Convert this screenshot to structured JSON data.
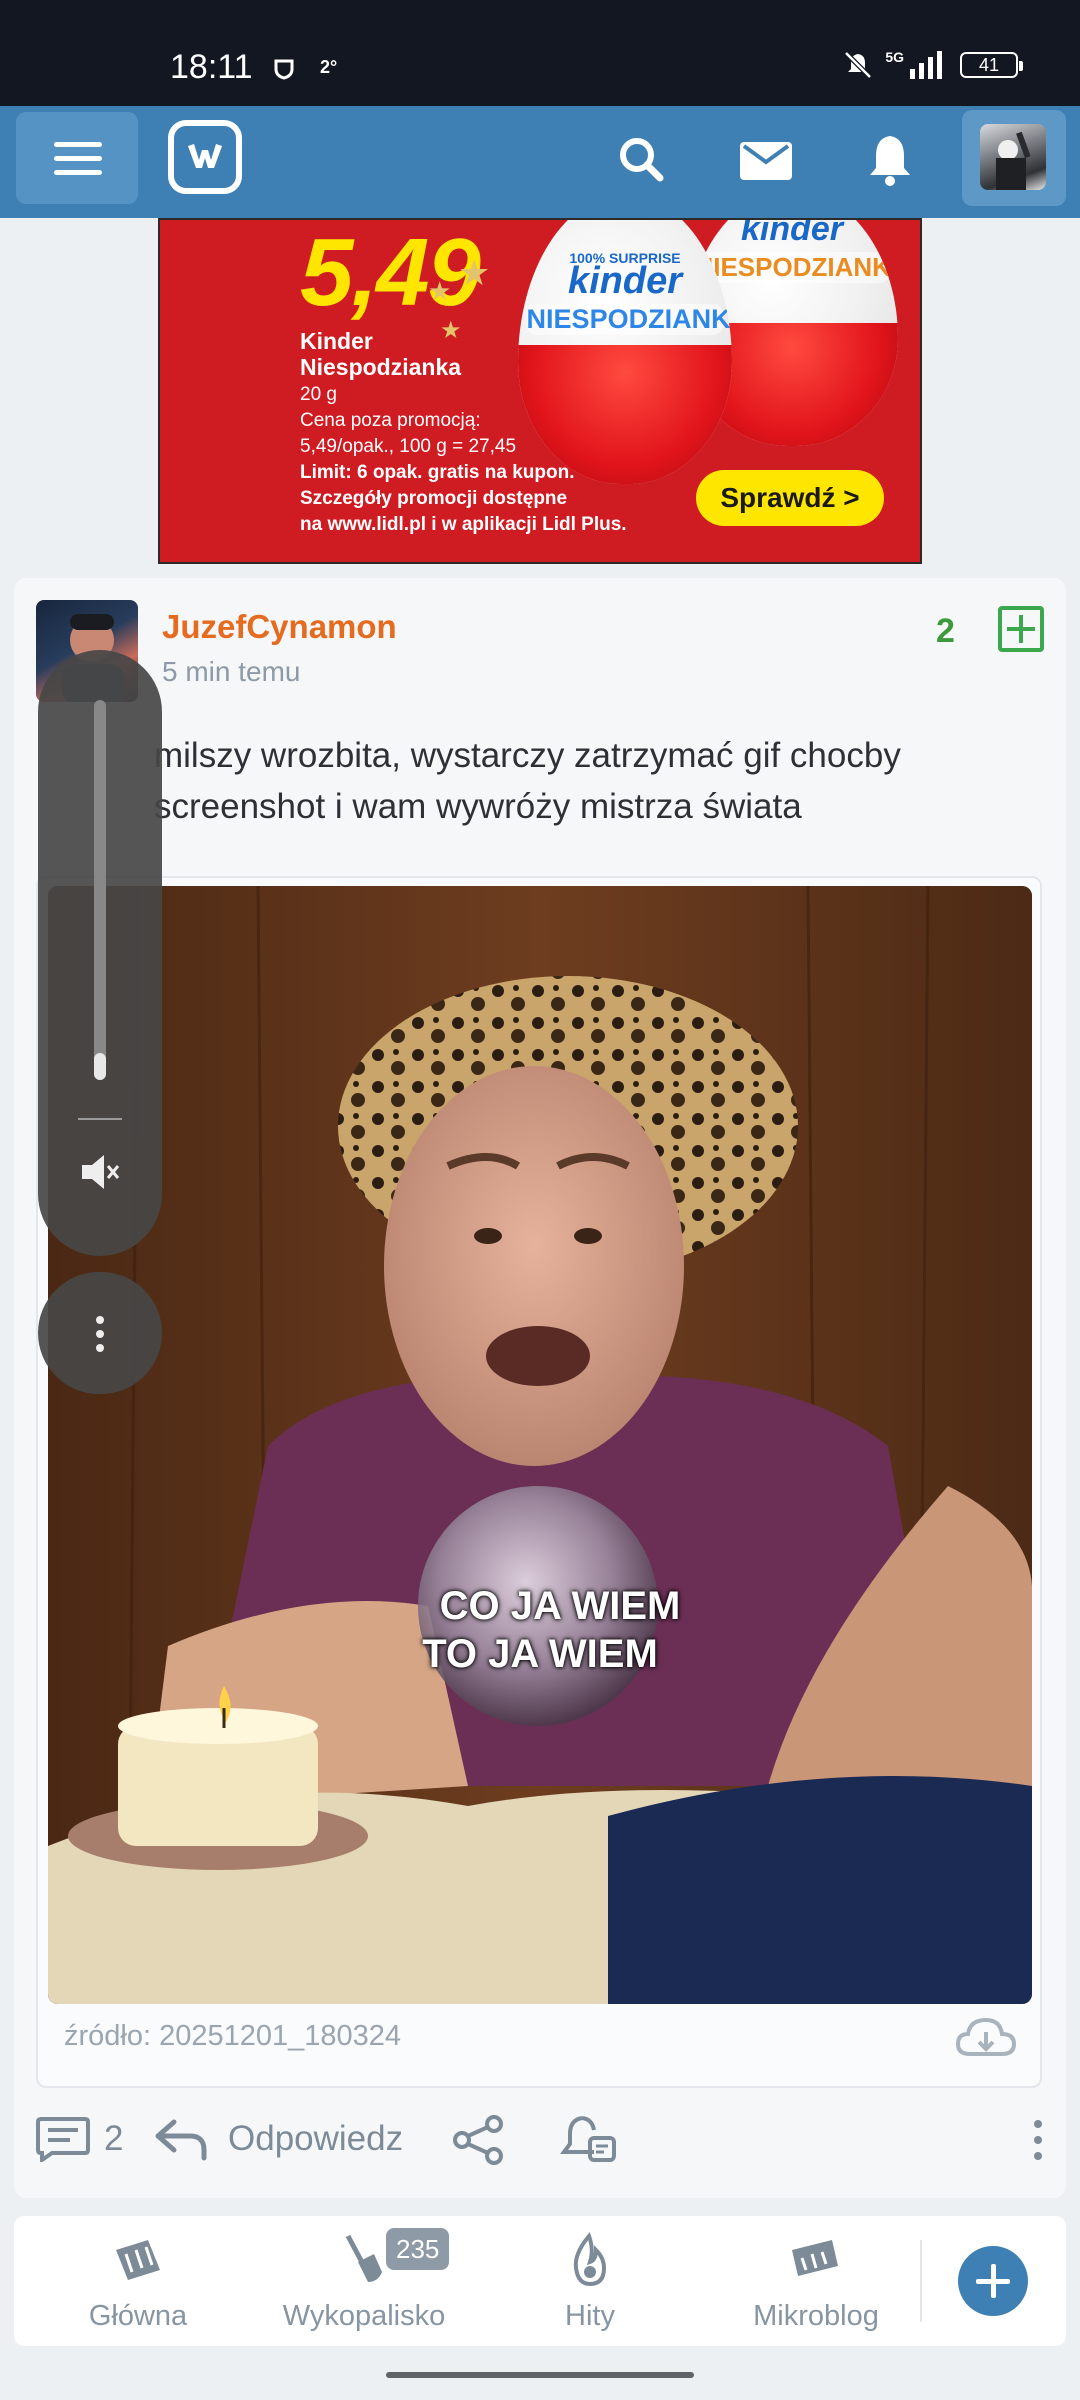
{
  "status_bar": {
    "time": "18:11",
    "temperature": "2°",
    "network": "5G",
    "battery": "41"
  },
  "app_bar": {
    "menu_icon": "hamburger-menu-icon",
    "logo": "wykop-logo",
    "search_icon": "search-icon",
    "messages_icon": "envelope-icon",
    "notifications_icon": "bell-icon",
    "avatar": "user-avatar"
  },
  "ad": {
    "price": "5,49",
    "product": "Kinder Niespodzianka",
    "weight": "20 g",
    "fine_lines": [
      "Cena poza promocją:",
      "5,49/opak., 100 g = 27,45",
      "Limit: 6 opak. gratis na kupon.",
      "Szczegóły promocji dostępne",
      "na www.lidl.pl i w aplikacji Lidl Plus."
    ],
    "egg_brand": "kinder",
    "egg_label": "NIESPODZIANKA",
    "cta": "Sprawdź >"
  },
  "post": {
    "author": "JuzefCynamon",
    "time_ago": "5 min temu",
    "votes": "2",
    "text_line1": "milszy wrozbita, wystarczy zatrzymać gif chocby",
    "text_line2": "screenshot i wam wywróży mistrza świata",
    "gif_caption_line1": "CO JA WIEM",
    "gif_caption_line2": "TO JA WIEM",
    "source": "źródło: 20251201_180324",
    "comment_count": "2",
    "reply_label": "Odpowiedz"
  },
  "volume_overlay": {
    "level": 0.07,
    "icon": "speaker-muted-icon"
  },
  "bottom_nav": {
    "items": [
      {
        "label": "Główna",
        "icon": "home-icon"
      },
      {
        "label": "Wykopalisko",
        "icon": "shovel-icon",
        "badge": "235"
      },
      {
        "label": "Hity",
        "icon": "flame-icon"
      },
      {
        "label": "Mikroblog",
        "icon": "microblog-icon"
      }
    ],
    "add_icon": "plus-icon"
  },
  "colors": {
    "brand_blue": "#3f80b4",
    "author_orange": "#e56b1f",
    "vote_green": "#3c9a3c",
    "ad_red": "#cf1b22",
    "ad_yellow": "#ffe600"
  }
}
